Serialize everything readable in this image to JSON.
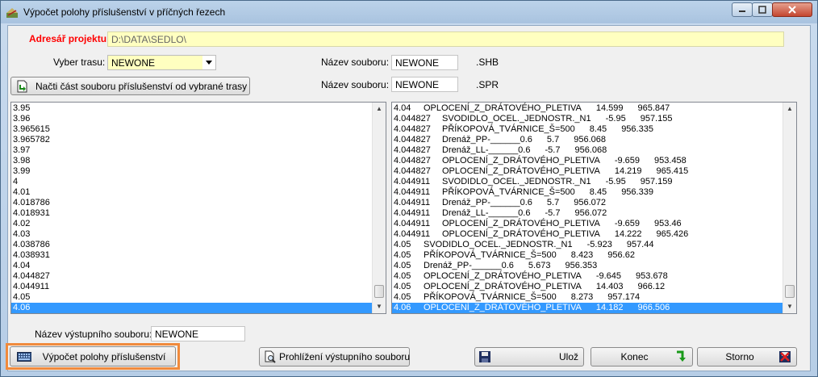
{
  "window": {
    "title": "Výpočet polohy příslušenství v příčných řezech"
  },
  "project": {
    "label": "Adresář projektu:",
    "path": "D:\\DATA\\SEDLO\\"
  },
  "route": {
    "label": "Vyber trasu:",
    "value": "NEWONE"
  },
  "shb_file": {
    "label": "Název souboru:",
    "value": "NEWONE",
    "ext": ".SHB"
  },
  "spr_file": {
    "label": "Název souboru:",
    "value": "NEWONE",
    "ext": ".SPR"
  },
  "load_button": {
    "label": "Načti část souboru příslušenství od vybrané trasy"
  },
  "stations": [
    "3.95",
    "3.96",
    "3.965615",
    "3.965782",
    "3.97",
    "3.98",
    "3.99",
    "4",
    "4.01",
    "4.018786",
    "4.018931",
    "4.02",
    "4.03",
    "4.038786",
    "4.038931",
    "4.04",
    "4.044827",
    "4.044911",
    "4.05",
    "4.06"
  ],
  "accessories": [
    {
      "st": "4.04",
      "name": "OPLOCENÍ_Z_DRÁTOVÉHO_PLETIVA",
      "off": "14.599",
      "h": "965.847"
    },
    {
      "st": "4.044827",
      "name": "SVODIDLO_OCEL._JEDNOSTR._N1",
      "off": "-5.95",
      "h": "957.155"
    },
    {
      "st": "4.044827",
      "name": "PŘÍKOPOVÁ_TVÁRNICE_Š=500",
      "off": "8.45",
      "h": "956.335"
    },
    {
      "st": "4.044827",
      "name": "Drenáž_PP-______0.6",
      "off": "5.7",
      "h": "956.068"
    },
    {
      "st": "4.044827",
      "name": "Drenáž_LL-______0.6",
      "off": "-5.7",
      "h": "956.068"
    },
    {
      "st": "4.044827",
      "name": "OPLOCENÍ_Z_DRÁTOVÉHO_PLETIVA",
      "off": "-9.659",
      "h": "953.458"
    },
    {
      "st": "4.044827",
      "name": "OPLOCENÍ_Z_DRÁTOVÉHO_PLETIVA",
      "off": "14.219",
      "h": "965.415"
    },
    {
      "st": "4.044911",
      "name": "SVODIDLO_OCEL._JEDNOSTR._N1",
      "off": "-5.95",
      "h": "957.159"
    },
    {
      "st": "4.044911",
      "name": "PŘÍKOPOVÁ_TVÁRNICE_Š=500",
      "off": "8.45",
      "h": "956.339"
    },
    {
      "st": "4.044911",
      "name": "Drenáž_PP-______0.6",
      "off": "5.7",
      "h": "956.072"
    },
    {
      "st": "4.044911",
      "name": "Drenáž_LL-______0.6",
      "off": "-5.7",
      "h": "956.072"
    },
    {
      "st": "4.044911",
      "name": "OPLOCENÍ_Z_DRÁTOVÉHO_PLETIVA",
      "off": "-9.659",
      "h": "953.46"
    },
    {
      "st": "4.044911",
      "name": "OPLOCENÍ_Z_DRÁTOVÉHO_PLETIVA",
      "off": "14.222",
      "h": "965.426"
    },
    {
      "st": "4.05",
      "name": "SVODIDLO_OCEL._JEDNOSTR._N1",
      "off": "-5.923",
      "h": "957.44"
    },
    {
      "st": "4.05",
      "name": "PŘÍKOPOVÁ_TVÁRNICE_Š=500",
      "off": "8.423",
      "h": "956.62"
    },
    {
      "st": "4.05",
      "name": "Drenáž_PP-______0.6",
      "off": "5.673",
      "h": "956.353"
    },
    {
      "st": "4.05",
      "name": "OPLOCENÍ_Z_DRÁTOVÉHO_PLETIVA",
      "off": "-9.645",
      "h": "953.678"
    },
    {
      "st": "4.05",
      "name": "OPLOCENÍ_Z_DRÁTOVÉHO_PLETIVA",
      "off": "14.403",
      "h": "966.12"
    },
    {
      "st": "4.05",
      "name": "PŘÍKOPOVÁ_TVÁRNICE_Š=500",
      "off": "8.273",
      "h": "957.174"
    },
    {
      "st": "4.06",
      "name": "OPLOCENÍ_Z_DRÁTOVÉHO_PLETIVA",
      "off": "14.182",
      "h": "966.506"
    }
  ],
  "output": {
    "label": "Název výstupního souboru:",
    "value": "NEWONE"
  },
  "buttons": {
    "compute": "Výpočet  polohy příslušenství",
    "preview": "Prohlížení výstupního souboru",
    "save": "Ulož",
    "end": "Konec",
    "cancel": "Storno"
  },
  "colors": {
    "required_label": "#ff0000",
    "path_bg": "#ffffc0",
    "selection": "#3399ff",
    "highlight_border": "#f08a3c"
  }
}
